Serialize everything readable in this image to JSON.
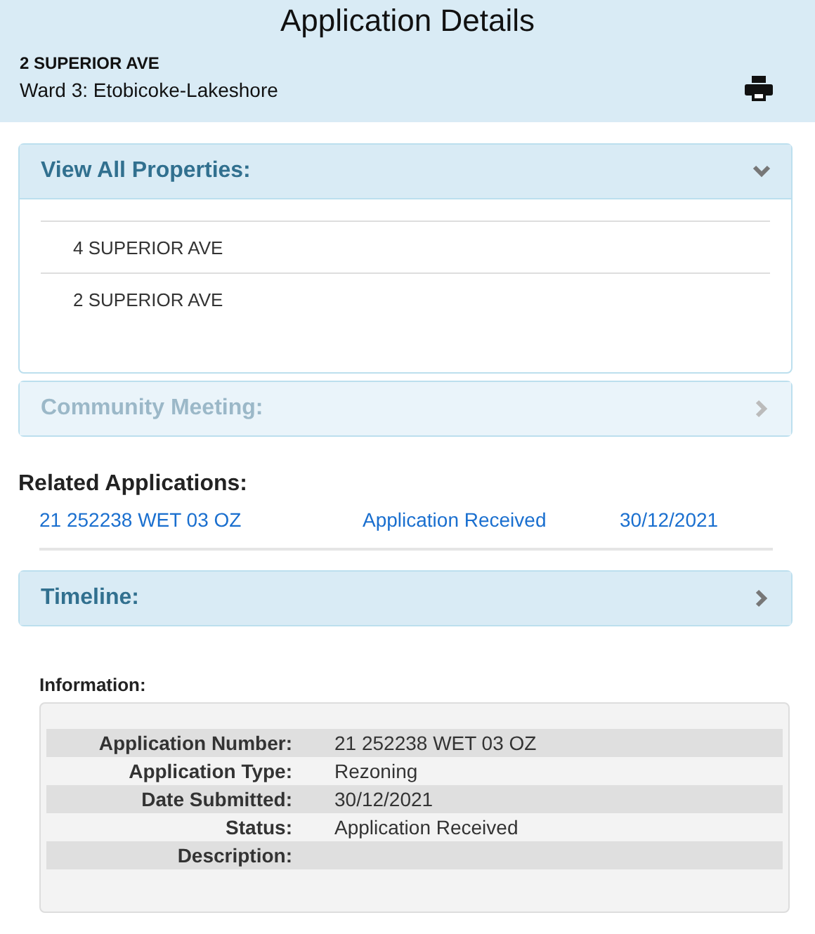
{
  "header": {
    "title": "Application Details",
    "address": "2 SUPERIOR AVE",
    "ward": "Ward 3: Etobicoke-Lakeshore"
  },
  "panels_top": [
    {
      "title": "View All Properties:",
      "expanded": true,
      "disabled": false,
      "items": [
        "4 SUPERIOR AVE",
        "2 SUPERIOR AVE"
      ]
    },
    {
      "title": "Community Meeting:",
      "expanded": false,
      "disabled": true
    }
  ],
  "related": {
    "heading": "Related Applications:",
    "rows": [
      {
        "number": "21 252238 WET 03 OZ",
        "status": "Application Received",
        "date": "30/12/2021"
      }
    ]
  },
  "panels_bottom": [
    {
      "title": "Timeline:",
      "expanded": false,
      "disabled": false
    }
  ],
  "information": {
    "heading": "Information:",
    "rows": [
      {
        "label": "Application Number:",
        "value": "21 252238 WET 03 OZ"
      },
      {
        "label": "Application Type:",
        "value": "Rezoning"
      },
      {
        "label": "Date Submitted:",
        "value": "30/12/2021"
      },
      {
        "label": "Status:",
        "value": "Application Received"
      },
      {
        "label": "Description:"
      }
    ]
  }
}
